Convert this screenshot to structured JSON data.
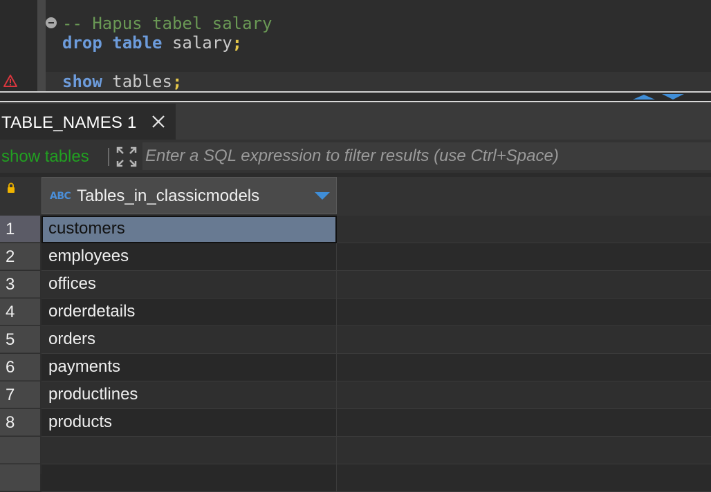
{
  "editor": {
    "comment": "-- Hapus tabel salary",
    "line2": {
      "kw1": "drop",
      "kw2": "table",
      "ident": "salary",
      "semi": ";"
    },
    "line3": {
      "kw1": "show",
      "ident": "tables",
      "semi": ";"
    }
  },
  "tab": {
    "label": "TABLE_NAMES 1"
  },
  "filter": {
    "label": "show tables",
    "placeholder": "Enter a SQL expression to filter results (use Ctrl+Space)"
  },
  "grid": {
    "type_badge": "ABC",
    "column": "Tables_in_classicmodels",
    "rows": [
      {
        "num": "1",
        "value": "customers"
      },
      {
        "num": "2",
        "value": "employees"
      },
      {
        "num": "3",
        "value": "offices"
      },
      {
        "num": "4",
        "value": "orderdetails"
      },
      {
        "num": "5",
        "value": "orders"
      },
      {
        "num": "6",
        "value": "payments"
      },
      {
        "num": "7",
        "value": "productlines"
      },
      {
        "num": "8",
        "value": "products"
      }
    ]
  },
  "colors": {
    "keyword": "#6d9cdc",
    "comment": "#6a9955",
    "accent": "#3f8ed8",
    "filter_label": "#21a021"
  }
}
